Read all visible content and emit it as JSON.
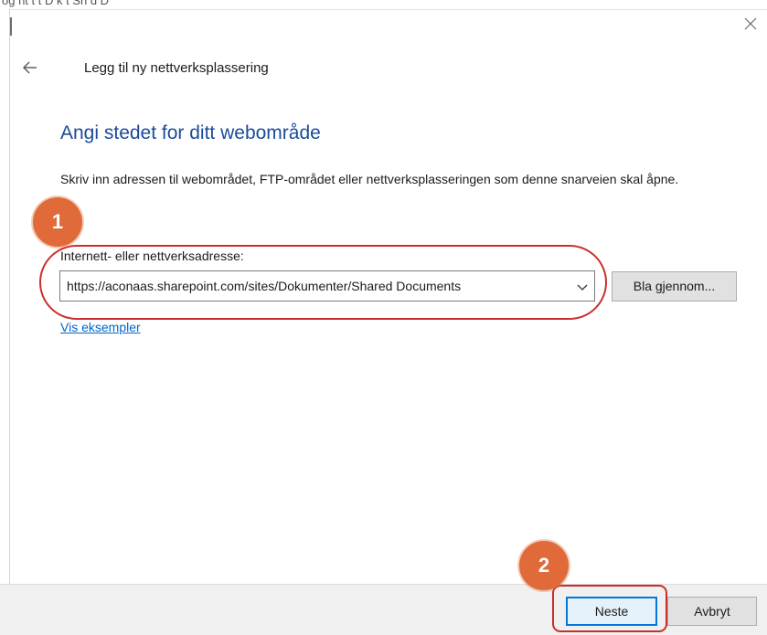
{
  "dialog": {
    "title": "Legg til ny nettverksplassering",
    "back_icon": "arrow-left-icon",
    "close_icon": "close-icon"
  },
  "content": {
    "heading": "Angi stedet for ditt webområde",
    "description": "Skriv inn adressen til webområdet, FTP-området eller nettverksplasseringen som denne snarveien skal åpne.",
    "address_label": "Internett- eller nettverksadresse:",
    "address_value": "https://aconaas.sharepoint.com/sites/Dokumenter/Shared Documents",
    "browse_label": "Bla gjennom...",
    "examples_link": "Vis eksempler"
  },
  "footer": {
    "next_label": "Neste",
    "cancel_label": "Avbryt"
  },
  "annotations": {
    "step1_label": "1",
    "step2_label": "2",
    "highlight_color": "#c9302c",
    "badge_color": "#e06a3a"
  },
  "colors": {
    "heading": "#1a4b9b",
    "link": "#0066cc",
    "footer_bg": "#f0f0f0",
    "primary_border": "#0078d7"
  }
}
